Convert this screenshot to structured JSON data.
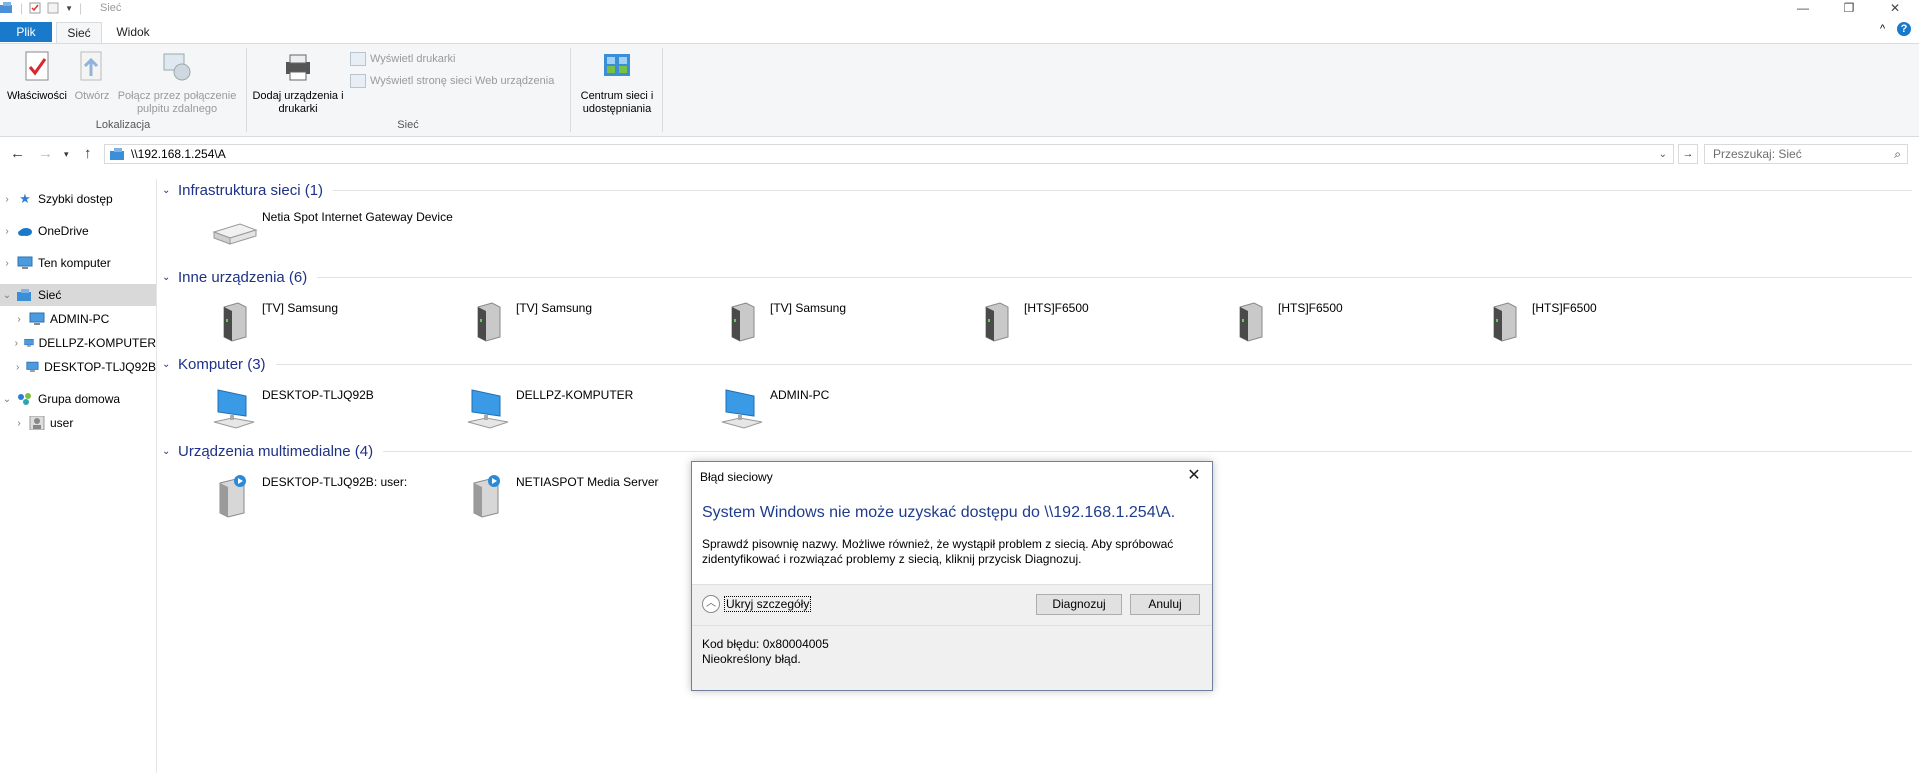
{
  "window": {
    "title": "Sieć",
    "controls": {
      "minimize": "—",
      "maximize": "❐",
      "close": "✕"
    }
  },
  "ribbon": {
    "tabs": [
      "Plik",
      "Sieć",
      "Widok"
    ],
    "right_controls": {
      "collapse": "^",
      "help": "?"
    },
    "groups": {
      "location": {
        "label": "Lokalizacja",
        "buttons": [
          "Właściwości",
          "Otwórz",
          "Połącz przez połączenie pulpitu zdalnego"
        ]
      },
      "network": {
        "label": "Sieć",
        "add_devices": "Dodaj urządzenia i drukarki",
        "small": [
          "Wyświetl drukarki",
          "Wyświetl stronę sieci Web urządzenia"
        ]
      },
      "center": {
        "button": "Centrum sieci i udostępniania"
      }
    }
  },
  "address": {
    "path": "\\\\192.168.1.254\\A",
    "search_placeholder": "Przeszukaj: Sieć"
  },
  "navpane": {
    "items": [
      {
        "label": "Szybki dostęp"
      },
      {
        "label": "OneDrive"
      },
      {
        "label": "Ten komputer"
      },
      {
        "label": "Sieć"
      },
      {
        "label": "ADMIN-PC"
      },
      {
        "label": "DELLPZ-KOMPUTER"
      },
      {
        "label": "DESKTOP-TLJQ92B"
      },
      {
        "label": "Grupa domowa"
      },
      {
        "label": "user"
      }
    ]
  },
  "content": {
    "groups": [
      {
        "title": "Infrastruktura sieci (1)",
        "items": [
          "Netia Spot Internet Gateway Device"
        ]
      },
      {
        "title": "Inne urządzenia (6)",
        "items": [
          "[TV] Samsung",
          "[TV] Samsung",
          "[TV] Samsung",
          "[HTS]F6500",
          "[HTS]F6500",
          "[HTS]F6500"
        ]
      },
      {
        "title": "Komputer (3)",
        "items": [
          "DESKTOP-TLJQ92B",
          "DELLPZ-KOMPUTER",
          "ADMIN-PC"
        ]
      },
      {
        "title": "Urządzenia multimedialne (4)",
        "items": [
          "DESKTOP-TLJQ92B: user:",
          "NETIASPOT Media Server"
        ]
      }
    ]
  },
  "dialog": {
    "title": "Błąd sieciowy",
    "heading": "System Windows nie może uzyskać dostępu do \\\\192.168.1.254\\A.",
    "description": "Sprawdź pisownię nazwy. Możliwe również, że wystąpił problem z siecią. Aby spróbować zidentyfikować i rozwiązać problemy z siecią, kliknij przycisk Diagnozuj.",
    "toggle_details": "Ukryj szczegóły",
    "diagnose": "Diagnozuj",
    "cancel": "Anuluj",
    "error_code": "Kod błędu: 0x80004005",
    "error_text": "Nieokreślony błąd."
  }
}
